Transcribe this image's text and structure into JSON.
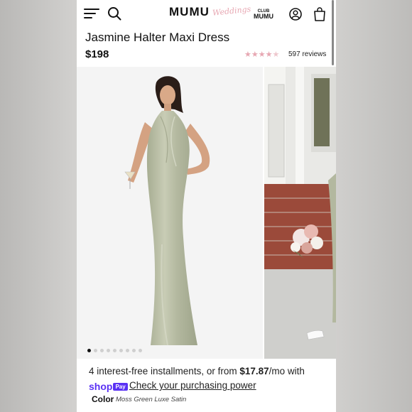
{
  "header": {
    "logo": "MUMU",
    "logo_script": "Weddings",
    "club_small": "CLUB",
    "club_big": "MUMU"
  },
  "product": {
    "title": "Jasmine Halter Maxi Dress",
    "price": "$198",
    "rating": 4.5,
    "rating_max": 5,
    "reviews": "597 reviews",
    "star_color": "#e7a7b2"
  },
  "gallery": {
    "image_count": 9,
    "current_index": 1
  },
  "payment": {
    "install_prefix": "4 interest-free installments, or from ",
    "install_amount": "$17.87",
    "install_suffix": "/mo with",
    "shop_text": "shop",
    "pay_badge": "Pay",
    "check_link": "Check your purchasing power",
    "accent": "#5a31f4"
  },
  "color": {
    "label": "Color",
    "value": "Moss Green Luxe Satin"
  },
  "icons": [
    "hamburger-menu-icon",
    "search-icon",
    "account-icon",
    "shopping-bag-icon"
  ]
}
